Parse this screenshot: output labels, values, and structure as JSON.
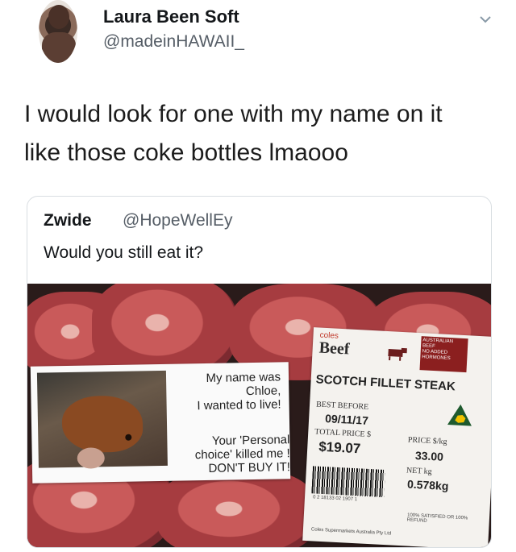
{
  "tweet": {
    "author_name": "Laura Been Soft",
    "author_handle": "@madeinHAWAII_",
    "text_line1": "I would look for one with my name on it",
    "text_line2": "like those coke bottles lmaooo"
  },
  "quoted_tweet": {
    "author_name": "Zwide",
    "author_handle": "@HopeWellEy",
    "text": "Would you still eat it?"
  },
  "sticker_left": {
    "line1": "My name was",
    "line2": "Chloe,",
    "line3": "I wanted to live!",
    "line4": "Your 'Personal",
    "line5": "choice' killed me !",
    "line6": "DON'T BUY IT!"
  },
  "label": {
    "brand": "coles",
    "category": "Beef",
    "badge_line1": "AUSTRALIAN",
    "badge_line2": "BEEF",
    "badge_line3": "NO ADDED",
    "badge_line4": "HORMONES",
    "product": "SCOTCH FILLET STEAK",
    "best_before_label": "BEST BEFORE",
    "best_before": "09/11/17",
    "total_price_label": "TOTAL PRICE $",
    "total_price": "$19.07",
    "price_per_kg_label": "PRICE $/kg",
    "price_per_kg": "33.00",
    "net_label": "NET kg",
    "net": "0.578kg",
    "barcode_number": "0 2 18133 02 1907 1",
    "guarantee": "100% SATISFIED OR 100% REFUND",
    "footer": "Coles Supermarkets Australia Pty Ltd"
  },
  "icons": {
    "chevron": "chevron-down-icon",
    "cow": "cow-icon",
    "australia": "australia-logo-icon"
  }
}
